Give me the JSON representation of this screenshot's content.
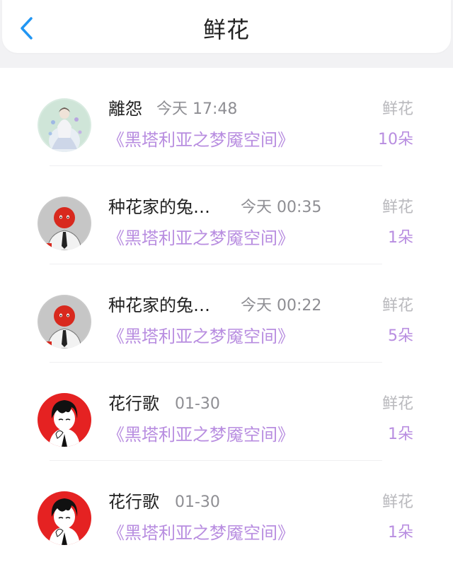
{
  "header": {
    "title": "鲜花",
    "back_icon": "chevron-left-icon",
    "accent_color": "#2196f3"
  },
  "colors": {
    "book_title": "#b88de0",
    "count": "#b88de0",
    "time": "#8e8e93",
    "label": "#b9b9bd"
  },
  "items": [
    {
      "username": "離怨",
      "time": "今天 17:48",
      "book": "《黑塔利亚之梦魇空间》",
      "label": "鲜花",
      "count": "10朵",
      "avatar": "lace-dress-avatar"
    },
    {
      "username": "种花家的兔…",
      "time": "今天 00:35",
      "book": "《黑塔利亚之梦魇空间》",
      "label": "鲜花",
      "count": "1朵",
      "avatar": "red-ball-avatar"
    },
    {
      "username": "种花家的兔…",
      "time": "今天 00:22",
      "book": "《黑塔利亚之梦魇空间》",
      "label": "鲜花",
      "count": "5朵",
      "avatar": "red-ball-avatar"
    },
    {
      "username": "花行歌",
      "time": "01-30",
      "book": "《黑塔利亚之梦魇空间》",
      "label": "鲜花",
      "count": "1朵",
      "avatar": "black-hair-avatar"
    },
    {
      "username": "花行歌",
      "time": "01-30",
      "book": "《黑塔利亚之梦魇空间》",
      "label": "鲜花",
      "count": "1朵",
      "avatar": "black-hair-avatar"
    }
  ]
}
